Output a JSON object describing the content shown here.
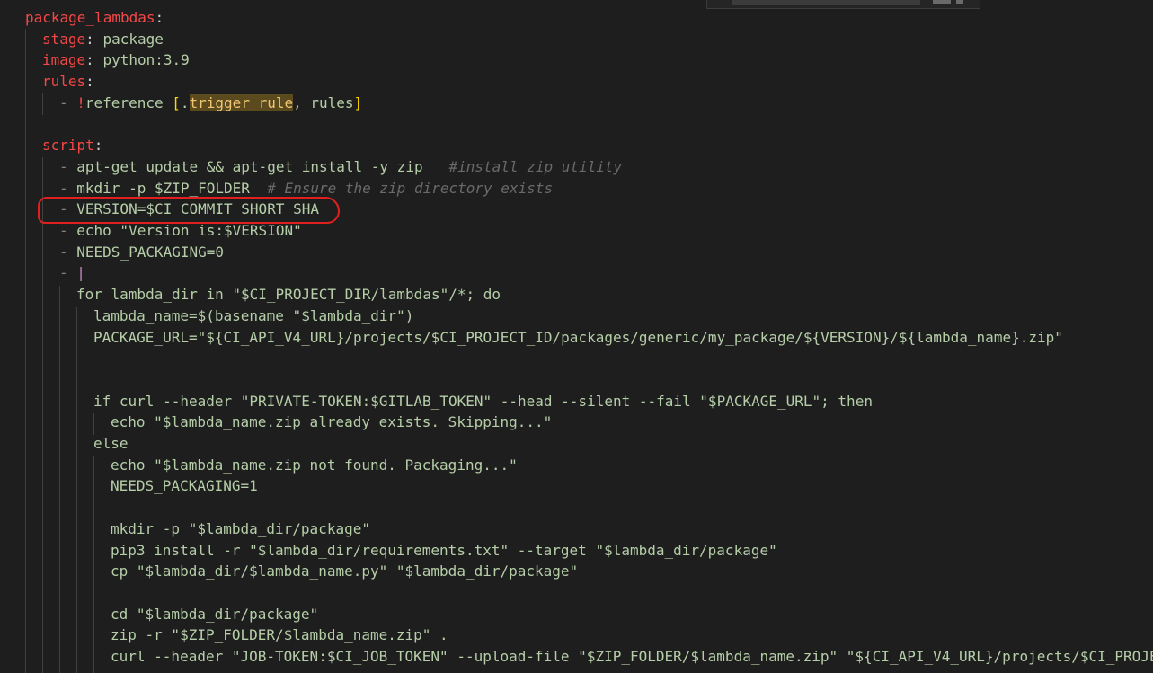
{
  "editor": {
    "lines": [
      {
        "parts": [
          {
            "c": "red",
            "t": "package_lambdas"
          },
          {
            "c": "punc",
            "t": ":"
          }
        ]
      },
      {
        "parts": [
          {
            "c": "red",
            "t": "stage"
          },
          {
            "c": "punc",
            "t": ": "
          },
          {
            "c": "shell",
            "t": "package"
          }
        ]
      },
      {
        "parts": [
          {
            "c": "red",
            "t": "image"
          },
          {
            "c": "punc",
            "t": ": "
          },
          {
            "c": "shell",
            "t": "python:3.9"
          }
        ]
      },
      {
        "parts": [
          {
            "c": "red",
            "t": "rules"
          },
          {
            "c": "punc",
            "t": ":"
          }
        ]
      },
      {
        "parts": [
          {
            "c": "dash",
            "t": "- "
          },
          {
            "c": "red",
            "t": "!"
          },
          {
            "c": "shell",
            "t": "reference "
          },
          {
            "c": "bracket",
            "t": "["
          },
          {
            "c": "shell",
            "t": "."
          },
          {
            "c": "hl",
            "t": "trigger_rule"
          },
          {
            "c": "shell",
            "t": ", rules"
          },
          {
            "c": "bracket",
            "t": "]"
          }
        ]
      },
      {
        "parts": []
      },
      {
        "parts": [
          {
            "c": "red",
            "t": "script"
          },
          {
            "c": "punc",
            "t": ":"
          }
        ]
      },
      {
        "parts": [
          {
            "c": "dash",
            "t": "- "
          },
          {
            "c": "shell",
            "t": "apt-get update && apt-get install -y zip   "
          },
          {
            "c": "cmt",
            "t": "#install zip utility"
          }
        ]
      },
      {
        "parts": [
          {
            "c": "dash",
            "t": "- "
          },
          {
            "c": "shell",
            "t": "mkdir -p $ZIP_FOLDER  "
          },
          {
            "c": "cmt",
            "t": "# Ensure the zip directory exists"
          }
        ]
      },
      {
        "parts": [
          {
            "c": "dash",
            "t": "- "
          },
          {
            "c": "shell",
            "t": "VERSION=$CI_COMMIT_SHORT_SHA"
          }
        ]
      },
      {
        "parts": [
          {
            "c": "dash",
            "t": "- "
          },
          {
            "c": "shell",
            "t": "echo \"Version is:$VERSION\""
          }
        ]
      },
      {
        "parts": [
          {
            "c": "dash",
            "t": "- "
          },
          {
            "c": "shell",
            "t": "NEEDS_PACKAGING=0"
          }
        ]
      },
      {
        "parts": [
          {
            "c": "dash",
            "t": "- "
          },
          {
            "c": "block",
            "t": "|"
          }
        ]
      },
      {
        "parts": [
          {
            "c": "shell",
            "t": "for lambda_dir in \"$CI_PROJECT_DIR/lambdas\"/*; do"
          }
        ]
      },
      {
        "parts": [
          {
            "c": "shell",
            "t": "lambda_name=$(basename \"$lambda_dir\")"
          }
        ]
      },
      {
        "parts": [
          {
            "c": "shell",
            "t": "PACKAGE_URL=\"${CI_API_V4_URL}/projects/$CI_PROJECT_ID/packages/generic/my_package/${VERSION}/${lambda_name}.zip\""
          }
        ]
      },
      {
        "parts": []
      },
      {
        "parts": []
      },
      {
        "parts": [
          {
            "c": "shell",
            "t": "if curl --header \"PRIVATE-TOKEN:$GITLAB_TOKEN\" --head --silent --fail \"$PACKAGE_URL\"; then"
          }
        ]
      },
      {
        "parts": [
          {
            "c": "shell",
            "t": "echo \"$lambda_name.zip already exists. Skipping...\""
          }
        ]
      },
      {
        "parts": [
          {
            "c": "shell",
            "t": "else"
          }
        ]
      },
      {
        "parts": [
          {
            "c": "shell",
            "t": "echo \"$lambda_name.zip not found. Packaging...\""
          }
        ]
      },
      {
        "parts": [
          {
            "c": "shell",
            "t": "NEEDS_PACKAGING=1"
          }
        ]
      },
      {
        "parts": []
      },
      {
        "parts": [
          {
            "c": "shell",
            "t": "mkdir -p \"$lambda_dir/package\""
          }
        ]
      },
      {
        "parts": [
          {
            "c": "shell",
            "t": "pip3 install -r \"$lambda_dir/requirements.txt\" --target \"$lambda_dir/package\""
          }
        ]
      },
      {
        "parts": [
          {
            "c": "shell",
            "t": "cp \"$lambda_dir/$lambda_name.py\" \"$lambda_dir/package\""
          }
        ]
      },
      {
        "parts": []
      },
      {
        "parts": [
          {
            "c": "shell",
            "t": "cd \"$lambda_dir/package\""
          }
        ]
      },
      {
        "parts": [
          {
            "c": "shell",
            "t": "zip -r \"$ZIP_FOLDER/$lambda_name.zip\" ."
          }
        ]
      },
      {
        "parts": [
          {
            "c": "shell",
            "t": "curl --header \"JOB-TOKEN:$CI_JOB_TOKEN\" --upload-file \"$ZIP_FOLDER/$lambda_name.zip\" \"${CI_API_V4_URL}/projects/$CI_PROJE"
          }
        ]
      }
    ]
  }
}
